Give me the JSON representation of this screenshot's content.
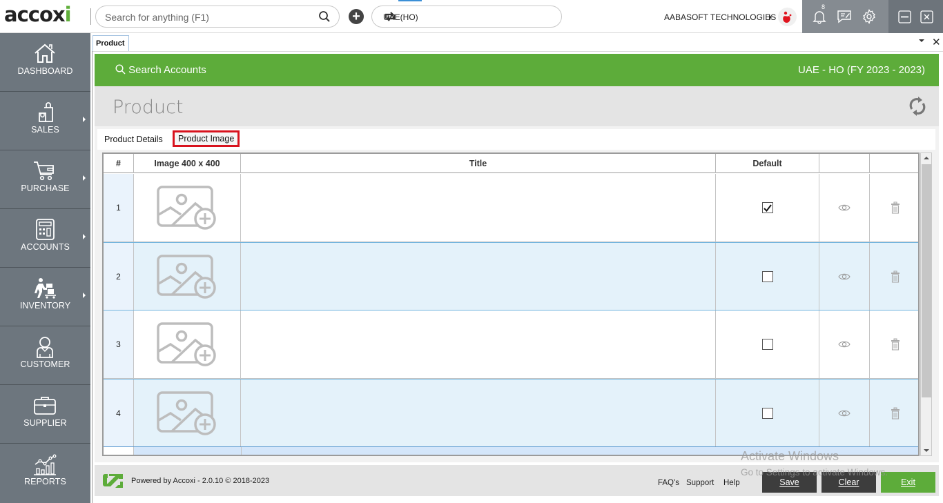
{
  "app": {
    "logo_text": "accoxi",
    "search_placeholder": "Search for anything (F1)",
    "branch": "UAE(HO)",
    "company": "AABASOFT TECHNOLOGIES",
    "notification_count": "8",
    "icons": {
      "search": "search-icon",
      "add": "plus-circle-icon",
      "refresh": "sync-icon",
      "notifications": "bell-icon",
      "messages": "message-icon",
      "settings": "gear-icon",
      "minimize": "minimize-icon",
      "close": "close-icon"
    }
  },
  "sidebar": {
    "items": [
      {
        "label": "DASHBOARD",
        "icon": "home-icon",
        "has_submenu": false
      },
      {
        "label": "SALES",
        "icon": "shopping-bag-icon",
        "has_submenu": true
      },
      {
        "label": "PURCHASE",
        "icon": "cart-icon",
        "has_submenu": true
      },
      {
        "label": "ACCOUNTS",
        "icon": "calculator-icon",
        "has_submenu": true
      },
      {
        "label": "INVENTORY",
        "icon": "inventory-icon",
        "has_submenu": true
      },
      {
        "label": "CUSTOMER",
        "icon": "user-icon",
        "has_submenu": false
      },
      {
        "label": "SUPPLIER",
        "icon": "briefcase-icon",
        "has_submenu": false
      },
      {
        "label": "REPORTS",
        "icon": "chart-icon",
        "has_submenu": false
      }
    ]
  },
  "doc_tab": {
    "label": "Product"
  },
  "header": {
    "search_accounts": "Search Accounts",
    "fiscal": "UAE - HO (FY 2023 - 2023)"
  },
  "page": {
    "title": "Product",
    "tabs": [
      {
        "label": "Product Details",
        "active": false
      },
      {
        "label": "Product Image",
        "active": true
      }
    ]
  },
  "table": {
    "columns": [
      "#",
      "Image 400 x 400",
      "Title",
      "Default",
      "",
      ""
    ],
    "rows": [
      {
        "num": "1",
        "title": "",
        "default": true
      },
      {
        "num": "2",
        "title": "",
        "default": false
      },
      {
        "num": "3",
        "title": "",
        "default": false
      },
      {
        "num": "4",
        "title": "",
        "default": false
      }
    ]
  },
  "footer": {
    "powered_by": "Powered by Accoxi - 2.0.10 © 2018-2023",
    "links": [
      "FAQ's",
      "Support",
      "Help"
    ],
    "buttons": {
      "save": "Save",
      "clear": "Clear",
      "exit": "Exit"
    }
  },
  "colors": {
    "accent_green": "#5dac3a",
    "sidebar_bg": "#6d767e",
    "dark_button": "#3d3d3d",
    "highlight_red": "#d8131e"
  },
  "watermark": {
    "line1": "Activate Windows",
    "line2": "Go to Settings to activate Windows."
  }
}
